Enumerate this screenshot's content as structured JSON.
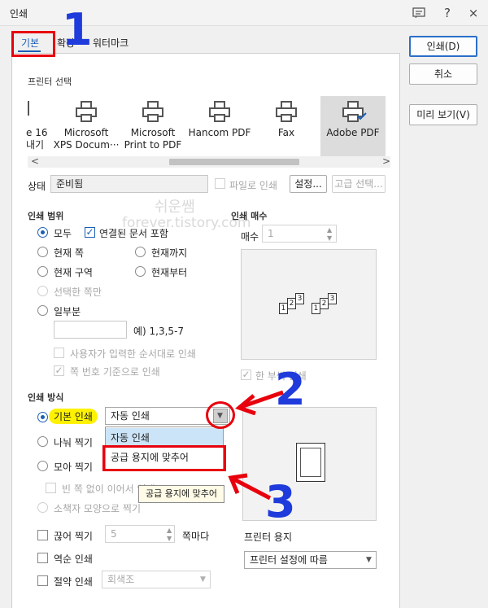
{
  "window": {
    "title": "인쇄",
    "help_icon": "?",
    "close_icon": "×"
  },
  "tabs": [
    {
      "label": "기본"
    },
    {
      "label": "확장"
    },
    {
      "label": "워터마크"
    }
  ],
  "buttons": {
    "print": "인쇄(D)",
    "cancel": "취소",
    "preview": "미리 보기(V)"
  },
  "printer_section": {
    "label": "프린터 선택",
    "printers": [
      {
        "line1": "e 16",
        "line2": "내기"
      },
      {
        "line1": "Microsoft",
        "line2": "XPS Docum···"
      },
      {
        "line1": "Microsoft",
        "line2": "Print to PDF"
      },
      {
        "line1": "Hancom PDF",
        "line2": ""
      },
      {
        "line1": "Fax",
        "line2": ""
      },
      {
        "line1": "Adobe PDF",
        "line2": ""
      }
    ],
    "scroll_left": "<",
    "scroll_right": ">"
  },
  "status": {
    "label": "상태",
    "value": "준비됨",
    "file_print_label": "파일로 인쇄",
    "settings_button": "설정...",
    "advanced_button": "고급 선택..."
  },
  "watermark": {
    "line1": "쉬운쌤",
    "line2": "forever.tistory.com"
  },
  "print_range": {
    "label": "인쇄 범위",
    "all": "모두",
    "linked_docs": "연결된 문서 포함",
    "current_page": "현재 쪽",
    "until_current": "현재까지",
    "current_section": "현재 구역",
    "from_current": "현재부터",
    "selected_only": "선택한 쪽만",
    "partial": "일부분",
    "example": "예) 1,3,5-7",
    "user_order": "사용자가 입력한 순서대로 인쇄",
    "page_number_based": "쪽 번호 기준으로 인쇄"
  },
  "copies": {
    "label": "인쇄 매수",
    "count_label": "매수",
    "count_value": "1",
    "collate_label": "한 부씩 인쇄",
    "sheet_labels": [
      "1",
      "2",
      "3",
      "1",
      "2",
      "3"
    ]
  },
  "print_method": {
    "label": "인쇄 방식",
    "basic": "기본 인쇄",
    "split": "나눠 찍기",
    "gather": "모아 찍기",
    "continuous": "빈 쪽 없이 이어서 인쇄",
    "booklet": "소책자 모양으로 찍기",
    "dropdown_value": "자동 인쇄",
    "dropdown_options": [
      "자동 인쇄",
      "공급 용지에 맞추어"
    ],
    "tooltip": "공급 용지에 맞추어",
    "cut_print": "끊어 찍기",
    "cut_value": "5",
    "per_page": "쪽마다",
    "reverse": "역순 인쇄",
    "save_ink": "절약 인쇄",
    "save_ink_value": "회색조",
    "printer_paper_label": "프린터 용지",
    "printer_paper_value": "프린터 설정에 따름"
  },
  "annotations": {
    "num1": "1",
    "num2": "2",
    "num3": "3"
  },
  "colors": {
    "accent": "#1a5fb4",
    "annotation_red": "#e8000d",
    "annotation_blue": "#1f3bdc",
    "highlight": "#fff200"
  }
}
